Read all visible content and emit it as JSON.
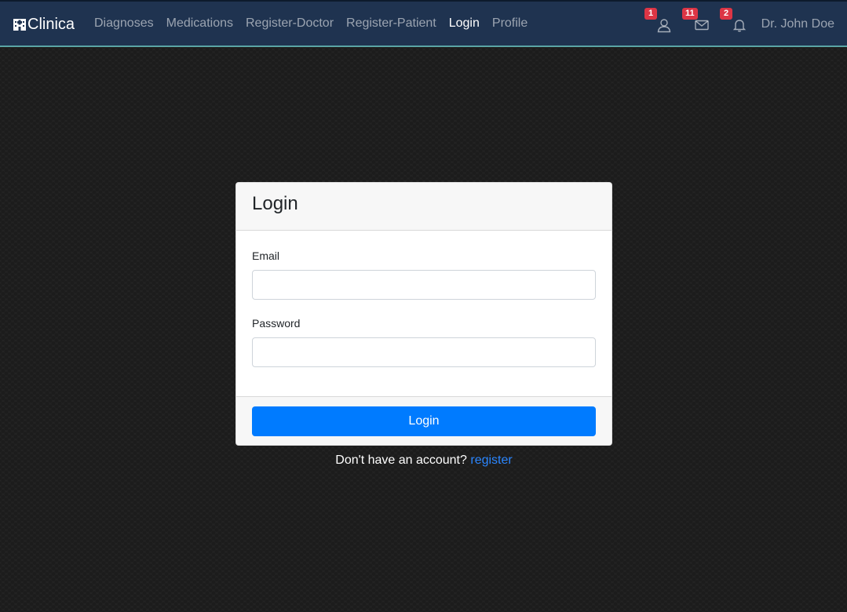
{
  "navbar": {
    "brand": "Clinica",
    "links": [
      {
        "label": "Diagnoses",
        "active": false
      },
      {
        "label": "Medications",
        "active": false
      },
      {
        "label": "Register-Doctor",
        "active": false
      },
      {
        "label": "Register-Patient",
        "active": false
      },
      {
        "label": "Login",
        "active": true
      },
      {
        "label": "Profile",
        "active": false
      }
    ],
    "icons": [
      {
        "name": "user-icon",
        "badge": "1"
      },
      {
        "name": "envelope-icon",
        "badge": "11"
      },
      {
        "name": "bell-icon",
        "badge": "2"
      }
    ],
    "user_name": "Dr. John Doe"
  },
  "login_card": {
    "title": "Login",
    "email_label": "Email",
    "email_value": "",
    "password_label": "Password",
    "password_value": "",
    "submit_label": "Login"
  },
  "register_prompt": {
    "text": "Don't have an account?",
    "link_label": "register"
  },
  "colors": {
    "navbar_bg": "#1f3350",
    "navbar_border": "#5aa5a5",
    "primary": "#007bff",
    "badge": "#dc3545",
    "link": "#2b86ff"
  }
}
